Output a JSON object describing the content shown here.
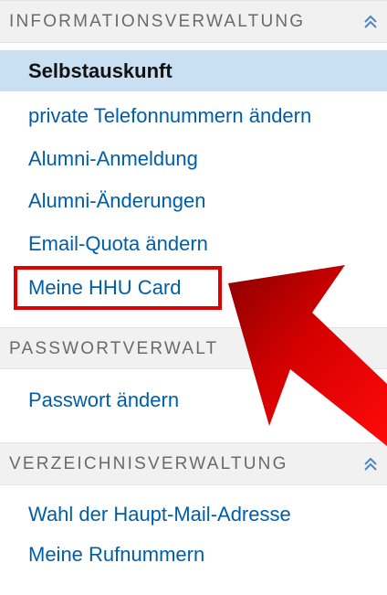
{
  "sections": [
    {
      "title": "INFORMATIONSVERWALTUNG",
      "icon": "double-chevron-up-icon",
      "items": [
        {
          "label": "Selbstauskunft",
          "active": true
        },
        {
          "label": "private Telefonnummern ändern"
        },
        {
          "label": "Alumni-Anmeldung"
        },
        {
          "label": "Alumni-Änderungen"
        },
        {
          "label": "Email-Quota ändern"
        },
        {
          "label": "Meine HHU Card",
          "highlighted": true
        }
      ]
    },
    {
      "title": "PASSWORTVERWALT",
      "items": [
        {
          "label": "Passwort ändern"
        }
      ]
    },
    {
      "title": "VERZEICHNISVERWALTUNG",
      "icon": "double-chevron-up-icon",
      "items": [
        {
          "label": "Wahl der Haupt-Mail-Adresse"
        },
        {
          "label": "Meine Rufnummern"
        }
      ]
    }
  ],
  "annotation": {
    "highlight_color": "#e00000",
    "arrow_color": "#d40000",
    "points_to": "Meine HHU Card"
  },
  "colors": {
    "link": "#005ea8",
    "active_bg": "#c9dff2",
    "header_bg": "#f1f1f1",
    "header_text": "#6a6a6a"
  }
}
